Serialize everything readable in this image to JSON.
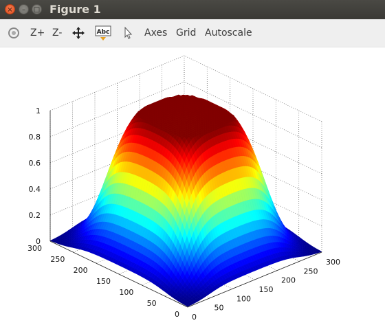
{
  "window": {
    "title": "Figure 1"
  },
  "toolbar": {
    "rotate_icon": "rotate-icon",
    "zoom_in_label": "Z+",
    "zoom_out_label": "Z-",
    "pan_icon": "pan-icon",
    "text_icon_label": "Abc",
    "select_icon": "pointer-icon",
    "axes_label": "Axes",
    "grid_label": "Grid",
    "autoscale_label": "Autoscale"
  },
  "chart_data": {
    "type": "surface",
    "colormap": "jet",
    "grid": true,
    "x_ticks": [
      "0",
      "50",
      "100",
      "150",
      "200",
      "250",
      "300"
    ],
    "y_ticks": [
      "0",
      "50",
      "100",
      "150",
      "200",
      "250",
      "300"
    ],
    "z_ticks": [
      "0",
      "0.2",
      "0.4",
      "0.6",
      "0.8",
      "1"
    ],
    "xlim": [
      0,
      300
    ],
    "ylim": [
      0,
      300
    ],
    "zlim": [
      0,
      1
    ],
    "surface": {
      "plateau_value": 1,
      "base_value": 0,
      "plateau_range": [
        50,
        250
      ],
      "shape": "smooth flat-topped square mesa"
    }
  }
}
